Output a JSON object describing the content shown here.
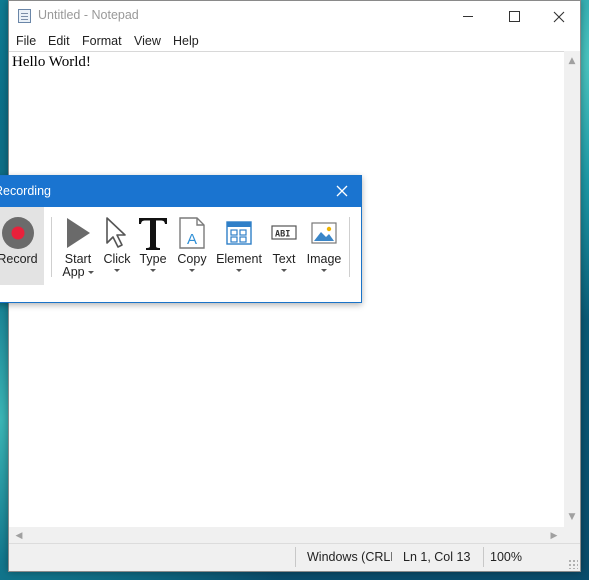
{
  "desktop": {},
  "notepad": {
    "title": "Untitled - Notepad",
    "menu": [
      "File",
      "Edit",
      "Format",
      "View",
      "Help"
    ],
    "content": "Hello World!",
    "status": {
      "eol": "Windows (CRLF)",
      "position": "Ln 1, Col 13",
      "zoom": "100%"
    }
  },
  "recorder": {
    "title": "Recording",
    "tools": {
      "record": "Record",
      "start_app": [
        "Start",
        "App"
      ],
      "click": "Click",
      "type": "Type",
      "copy": "Copy",
      "element": "Element",
      "text": "Text",
      "image": "Image"
    }
  },
  "colors": {
    "accent": "#1a74d0",
    "record_red": "#e8213b"
  },
  "icons": {
    "notepad_app": "notepad-icon",
    "minimize": "minimize-icon",
    "maximize": "maximize-icon",
    "close": "close-icon",
    "record": "record-icon",
    "start_app": "play-icon",
    "click": "cursor-icon",
    "type": "type-icon",
    "copy": "document-copy-icon",
    "element": "element-grid-icon",
    "text": "text-field-icon",
    "image": "image-icon"
  }
}
